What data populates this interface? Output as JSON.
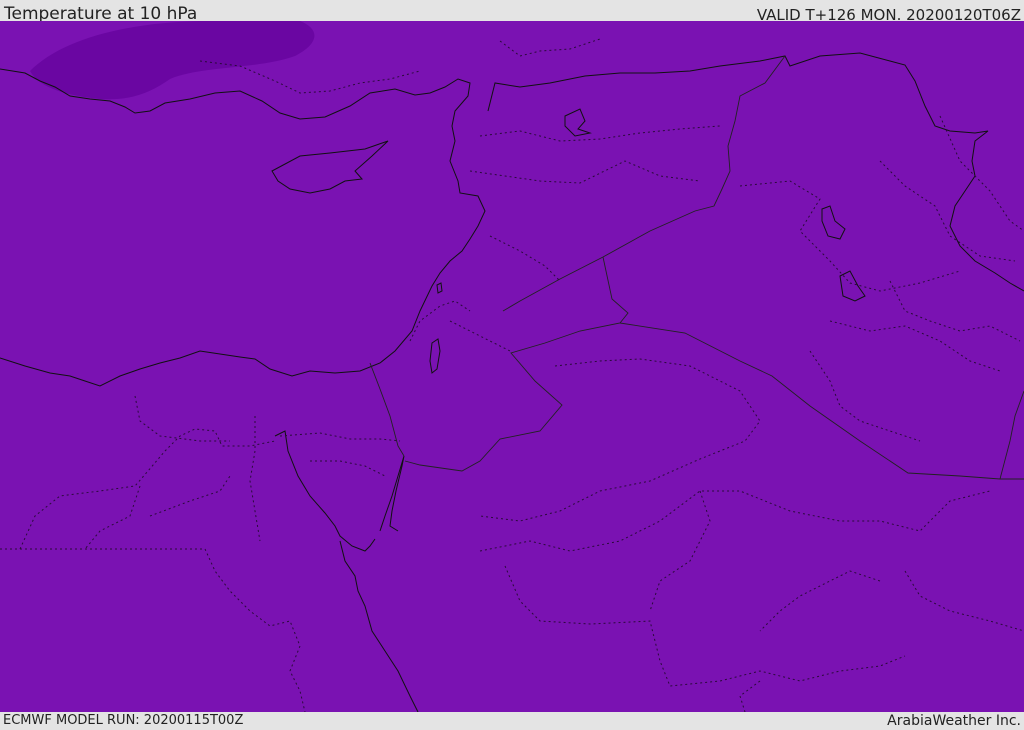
{
  "header": {
    "title": "Temperature at 10 hPa",
    "valid": "VALID T+126 MON. 20200120T06Z"
  },
  "footer": {
    "model_run": "ECMWF MODEL RUN: 20200115T00Z",
    "credit": "ArabiaWeather Inc."
  },
  "map": {
    "fill_color": "#7a12b2",
    "cold_pocket_color": "#6a06a2",
    "coastline_color": "#111111"
  }
}
